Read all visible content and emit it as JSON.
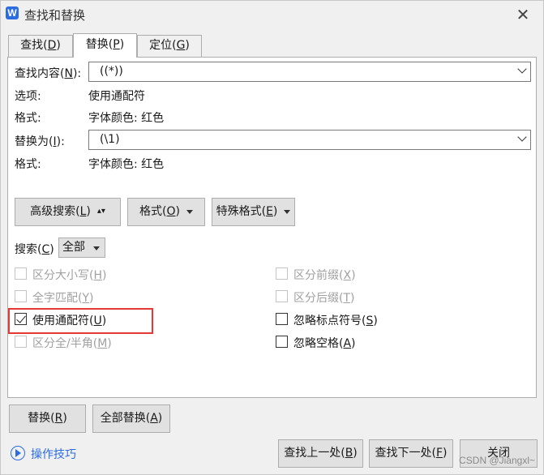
{
  "window": {
    "title": "查找和替换",
    "app_icon": "W",
    "close": "✕"
  },
  "tabs": [
    {
      "label": "查找",
      "key": "D"
    },
    {
      "label": "替换",
      "key": "P"
    },
    {
      "label": "定位",
      "key": "G"
    }
  ],
  "find": {
    "label": "查找内容",
    "key": "N",
    "value": "((*))"
  },
  "options_row": {
    "label": "选项:",
    "value": "使用通配符"
  },
  "format_find": {
    "label": "格式:",
    "value": "字体颜色: 红色"
  },
  "replace": {
    "label": "替换为",
    "key": "I",
    "value": "(\\1)"
  },
  "format_replace": {
    "label": "格式:",
    "value": "字体颜色: 红色"
  },
  "buttons": {
    "advanced": {
      "label": "高级搜索",
      "key": "L"
    },
    "format": {
      "label": "格式",
      "key": "O"
    },
    "special": {
      "label": "特殊格式",
      "key": "E"
    }
  },
  "search": {
    "label": "搜索",
    "key": "C",
    "value": "全部"
  },
  "checkboxes_left": [
    {
      "label": "区分大小写",
      "key": "H",
      "checked": false,
      "enabled": false
    },
    {
      "label": "全字匹配",
      "key": "Y",
      "checked": false,
      "enabled": false
    },
    {
      "label": "使用通配符",
      "key": "U",
      "checked": true,
      "enabled": true
    },
    {
      "label": "区分全/半角",
      "key": "M",
      "checked": false,
      "enabled": false
    }
  ],
  "checkboxes_right": [
    {
      "label": "区分前缀",
      "key": "X",
      "checked": false,
      "enabled": false
    },
    {
      "label": "区分后缀",
      "key": "T",
      "checked": false,
      "enabled": false
    },
    {
      "label": "忽略标点符号",
      "key": "S",
      "checked": false,
      "enabled": true
    },
    {
      "label": "忽略空格",
      "key": "A",
      "checked": false,
      "enabled": true
    }
  ],
  "actions": {
    "replace": {
      "label": "替换",
      "key": "R"
    },
    "replace_all": {
      "label": "全部替换",
      "key": "A"
    },
    "find_prev": {
      "label": "查找上一处",
      "key": "B"
    },
    "find_next": {
      "label": "查找下一处",
      "key": "F"
    },
    "close": "关闭"
  },
  "tips": "操作技巧",
  "watermark": "CSDN @Jiangxl~",
  "colors": {
    "highlight": "#e53935",
    "link": "#2b6de0"
  }
}
